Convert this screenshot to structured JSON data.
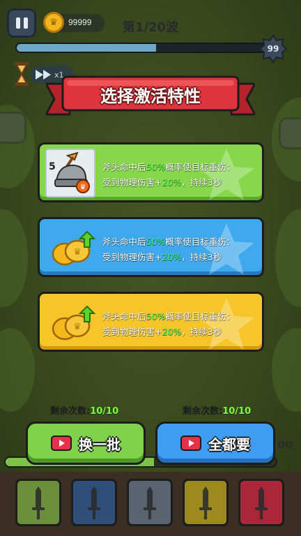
{
  "hud": {
    "coins": "99999",
    "coin_symbol": "♛",
    "wave_label": "第1/20波",
    "wave_progress": 0.56,
    "wave_badge": "99",
    "speed_label": "x1"
  },
  "dialog": {
    "title": "选择激活特性",
    "cards": [
      {
        "theme": "green",
        "icon": "helmet-axe-icon",
        "level": "5",
        "desc_line1_a": "斧头命中后",
        "desc_line1_hl": "50%",
        "desc_line1_b": "概率使目标重伤：",
        "desc_line2_a": "受到物理伤害+",
        "desc_line2_hl": "20%",
        "desc_line2_b": "，持续3秒"
      },
      {
        "theme": "blue",
        "icon": "gold-coins-up-icon",
        "desc_line1_a": "斧头命中后",
        "desc_line1_hl": "50%",
        "desc_line1_b": "概率使目标重伤：",
        "desc_line2_a": "受到物理伤害+",
        "desc_line2_hl": "20%",
        "desc_line2_b": "，持续3秒"
      },
      {
        "theme": "gold",
        "icon": "gold-coins-up-icon",
        "desc_line1_a": "斧头命中后",
        "desc_line1_hl": "50%",
        "desc_line1_b": "概率使目标重伤：",
        "desc_line2_a": "受到物理伤害+",
        "desc_line2_hl": "20%",
        "desc_line2_b": "，持续3秒"
      }
    ],
    "refresh": {
      "remain_label": "剩余次数:",
      "remain_value": "10/10",
      "button_label": "换一批"
    },
    "take_all": {
      "remain_label": "剩余次数:",
      "remain_value": "10/10",
      "button_label": "全都要"
    }
  },
  "exp": {
    "progress": 0.55,
    "tail_text": "00"
  },
  "slots": [
    {
      "color": "#6c8f3c"
    },
    {
      "color": "#2f4e7a"
    },
    {
      "color": "#5a6470"
    },
    {
      "color": "#9c8a1e"
    },
    {
      "color": "#a8283a"
    }
  ],
  "colors": {
    "highlight": "#59ff5a",
    "green_card": "#86d84a",
    "blue_card": "#3fa9ee",
    "gold_card": "#f6c52a",
    "banner_red": "#e0343c"
  }
}
